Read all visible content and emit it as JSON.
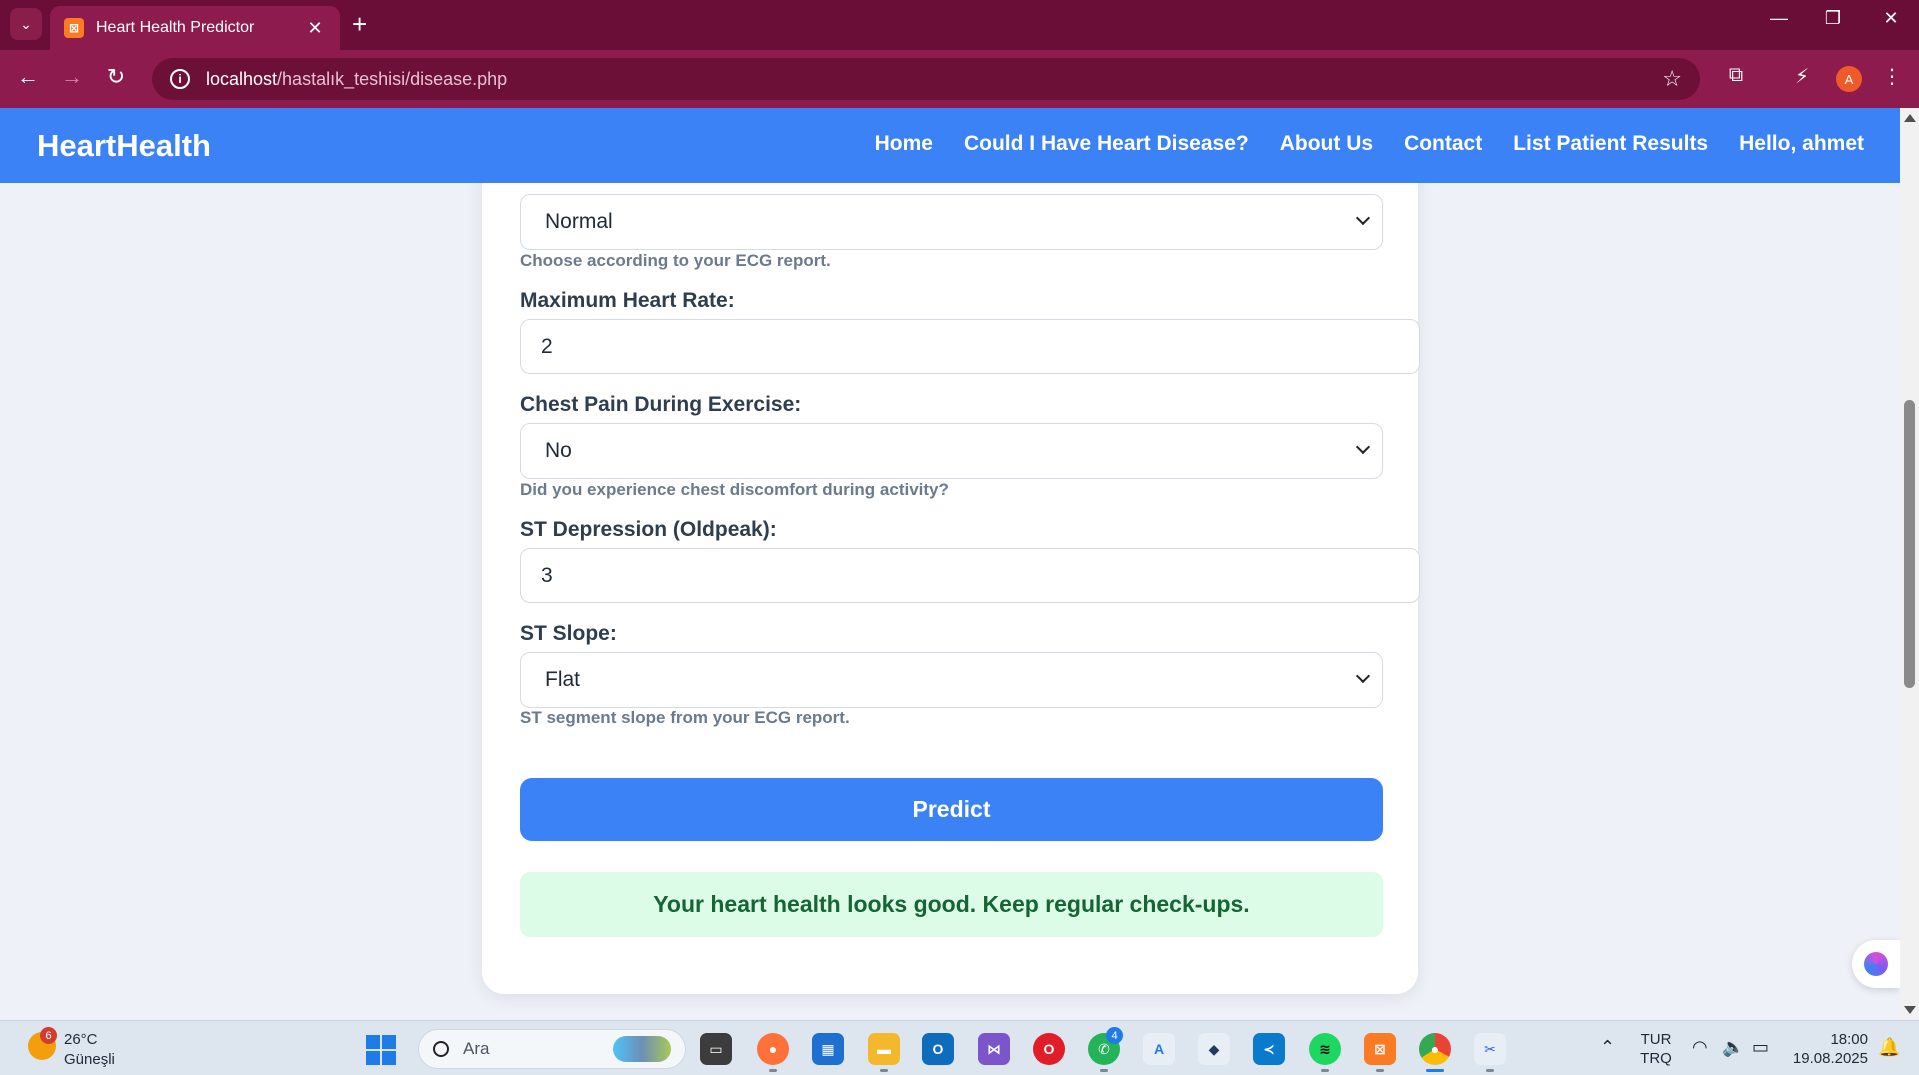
{
  "browser": {
    "tab_title": "Heart Health Predictor",
    "tab_favicon": "XAMPP",
    "url_host": "localhost",
    "url_path": "/hastalık_teshisi/disease.php",
    "profile_initial": "A"
  },
  "site": {
    "brand": "HeartHealth",
    "nav": {
      "home": "Home",
      "predict": "Could I Have Heart Disease?",
      "about": "About Us",
      "contact": "Contact",
      "results": "List Patient Results",
      "user": "Hello, ahmet"
    }
  },
  "form": {
    "ecg": {
      "value": "Normal",
      "hint": "Choose according to your ECG report."
    },
    "max_hr": {
      "label": "Maximum Heart Rate:",
      "value": "2"
    },
    "exercise_angina": {
      "label": "Chest Pain During Exercise:",
      "value": "No",
      "hint": "Did you experience chest discomfort during activity?"
    },
    "oldpeak": {
      "label": "ST Depression (Oldpeak):",
      "value": "3"
    },
    "st_slope": {
      "label": "ST Slope:",
      "value": "Flat",
      "hint": "ST segment slope from your ECG report."
    },
    "submit_label": "Predict",
    "result": "Your heart health looks good. Keep regular check-ups."
  },
  "taskbar": {
    "weather_badge": "6",
    "weather_temp": "26°C",
    "weather_desc": "Güneşli",
    "search_placeholder": "Ara",
    "whatsapp_badge": "4",
    "lang_primary": "TUR",
    "lang_secondary": "TRQ",
    "time": "18:00",
    "date": "19.08.2025"
  },
  "colors": {
    "accent": "#3b82f6",
    "browser_frame": "#6a0d37",
    "success_bg": "#dcfce7",
    "success_text": "#166534"
  }
}
